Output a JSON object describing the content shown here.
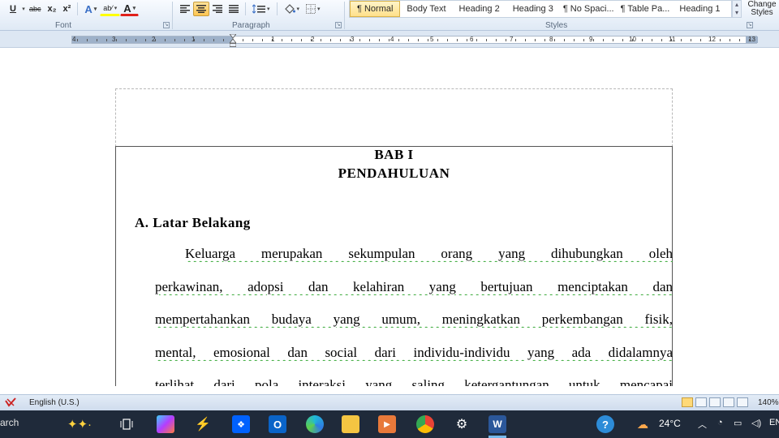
{
  "ribbon": {
    "font_group": {
      "label": "Font",
      "buttons": [
        "U",
        "abc",
        "x₂",
        "x²",
        "A",
        "ab⁄",
        "A"
      ]
    },
    "paragraph_group": {
      "label": "Paragraph"
    },
    "styles_group": {
      "label": "Styles",
      "items": [
        "¶ Normal",
        "Body Text",
        "Heading 2",
        "Heading 3",
        "¶ No Spaci...",
        "¶ Table Pa...",
        "Heading 1"
      ],
      "selected": "¶ Normal",
      "change_styles": "Change Styles"
    }
  },
  "ruler": {
    "numbers_left": [
      "4",
      "3",
      "2",
      "1"
    ],
    "numbers_right": [
      "1",
      "2",
      "3",
      "4",
      "5",
      "6",
      "7",
      "8",
      "9",
      "10",
      "11",
      "12",
      "13"
    ]
  },
  "document": {
    "chapter_number": "BAB I",
    "chapter_title": "PENDAHULUAN",
    "section_heading": "A.  Latar Belakang",
    "paragraph_lines": [
      "Keluarga merupakan sekumpulan orang yang dihubungkan oleh",
      "perkawinan, adopsi dan kelahiran yang bertujuan menciptakan dan",
      "mempertahankan budaya yang umum, meningkatkan perkembangan fisik,",
      "mental, emosional dan social dari individu-individu yang ada didalamnya",
      "terlihat dari pola interaksi yang saling ketergantungan untuk mencapai"
    ]
  },
  "statusbar": {
    "language": "English (U.S.)",
    "zoom": "140%"
  },
  "taskbar": {
    "search_text": "arch",
    "temperature": "24°C",
    "tray_lang": "EN",
    "colors": {
      "background": "#1f2a3a",
      "accent": "#76b9ed"
    }
  }
}
